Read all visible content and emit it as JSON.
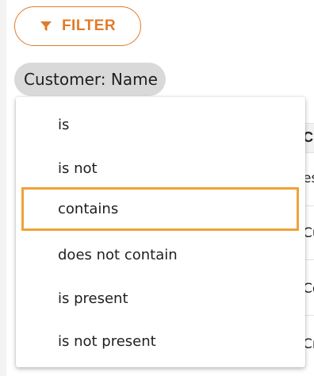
{
  "toolbar": {
    "filter_label": "FILTER",
    "filter_icon": "filter-icon",
    "accent_color": "#e07b2a"
  },
  "chip": {
    "label": "Customer: Name"
  },
  "menu": {
    "items": [
      {
        "label": "is"
      },
      {
        "label": "is not"
      },
      {
        "label": "contains",
        "highlighted": true
      },
      {
        "label": "does not contain"
      },
      {
        "label": "is present"
      },
      {
        "label": "is not present"
      }
    ],
    "highlight_color": "#f0a23a"
  },
  "table_peek": {
    "header": "Cu",
    "rows": [
      "es",
      "Cu",
      "Co",
      "Cr"
    ]
  }
}
